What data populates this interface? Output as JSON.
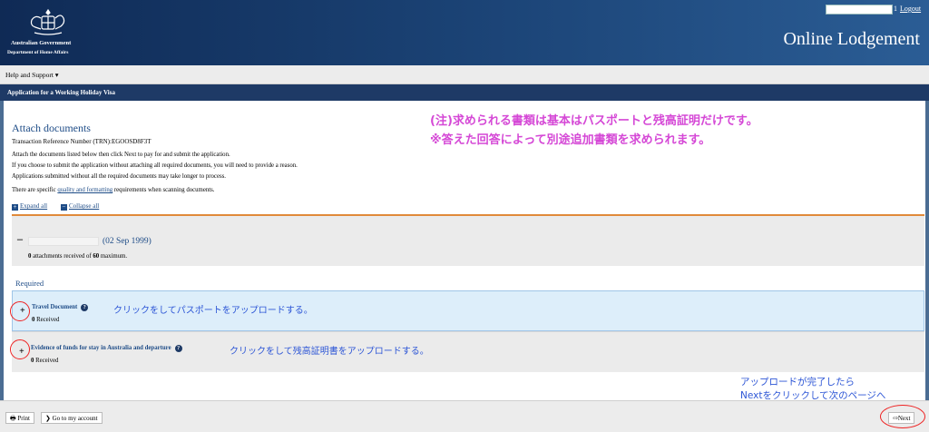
{
  "header": {
    "crest_icon": "coat-of-arms-icon",
    "gov_line1": "Australian Government",
    "gov_line2": "Department of Home Affairs",
    "user_suffix": "1",
    "logout": "Logout",
    "app_title": "Online Lodgement"
  },
  "menu": {
    "help": "Help and Support ▾"
  },
  "appbar": {
    "title": "Application for a Working Holiday Visa"
  },
  "main": {
    "title": "Attach documents",
    "trn": "Transaction Reference Number (TRN):EGOOSD8F3T",
    "instructions": [
      "Attach the documents listed below then click Next to pay for and submit the application.",
      "If you choose to submit the application without attaching all required documents, you will need to provide a reason.",
      "Applications submitted without all the required documents may take longer to process."
    ],
    "specific_pre": "There are specific ",
    "specific_link": "quality and formatting",
    "specific_post": " requirements when scanning documents.",
    "expand_all": "Expand all",
    "collapse_all": "Collapse all",
    "applicant": {
      "collapse_sign": "–",
      "dob": "(02 Sep 1999)",
      "attach_count": "0",
      "attach_mid": " attachments received of ",
      "attach_max": "60",
      "attach_end": " maximum."
    },
    "required_label": "Required",
    "documents": [
      {
        "name": "Travel Document",
        "received": "Received",
        "count": "0"
      },
      {
        "name": "Evidence of funds for stay in Australia and departure",
        "received": "Received",
        "count": "0"
      }
    ]
  },
  "annotations": {
    "note1": "(注)求められる書類は基本はパスポートと残高証明だけです。",
    "note2": "※答えた回答によって別途追加書類を求められます。",
    "doc_note1": "クリックをしてパスポートをアップロードする。",
    "doc_note2": "クリックをして残高証明書をアップロードする。",
    "next_note1": "アップロードが完了したら",
    "next_note2": "Nextをクリックして次のページへ"
  },
  "footer": {
    "print": "Print",
    "goto_account": "Go to my account",
    "next": "Next"
  },
  "colors": {
    "header_dark": "#0f2a55",
    "link_blue": "#1e4c87",
    "annot_pink": "#d548d6",
    "annot_blue": "#2d56d6",
    "accent_orange": "#e08a3a"
  }
}
